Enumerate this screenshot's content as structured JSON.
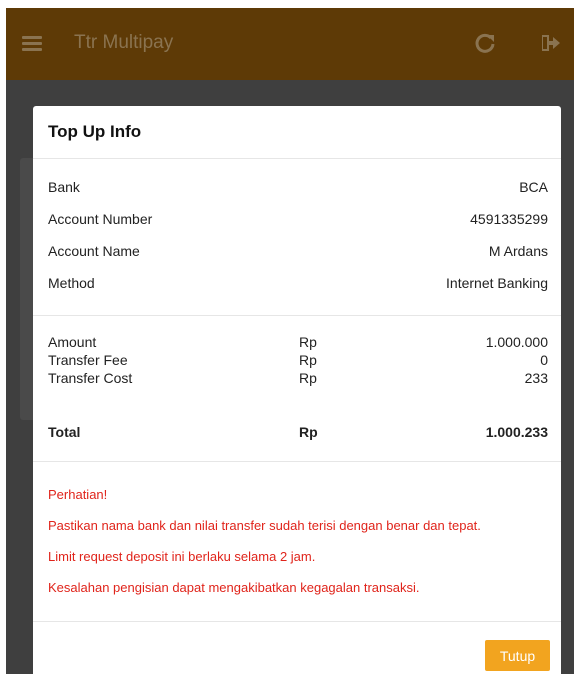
{
  "app": {
    "title": "Ttr Multipay",
    "icons": [
      "menu-icon",
      "refresh-icon",
      "logout-icon"
    ]
  },
  "modal": {
    "title": "Top Up Info",
    "info": [
      {
        "label": "Bank",
        "value": "BCA"
      },
      {
        "label": "Account Number",
        "value": "4591335299"
      },
      {
        "label": "Account Name",
        "value": "M Ardans"
      },
      {
        "label": "Method",
        "value": "Internet Banking"
      }
    ],
    "amounts": [
      {
        "label": "Amount",
        "currency": "Rp",
        "value": "1.000.000"
      },
      {
        "label": "Transfer Fee",
        "currency": "Rp",
        "value": "0"
      },
      {
        "label": "Transfer Cost",
        "currency": "Rp",
        "value": "233"
      }
    ],
    "total": {
      "label": "Total",
      "currency": "Rp",
      "value": "1.000.233"
    },
    "notice": [
      "Perhatian!",
      "Pastikan nama bank dan nilai transfer sudah terisi dengan benar dan tepat.",
      "Limit request deposit ini berlaku selama 2 jam.",
      "Kesalahan pengisian dapat mengakibatkan kegagalan transaksi."
    ],
    "close_label": "Tutup"
  },
  "colors": {
    "appbar": "#7a4a06",
    "notice_text": "#e0241b",
    "button": "#f2a41f",
    "overlay": "#3f3f3f"
  }
}
